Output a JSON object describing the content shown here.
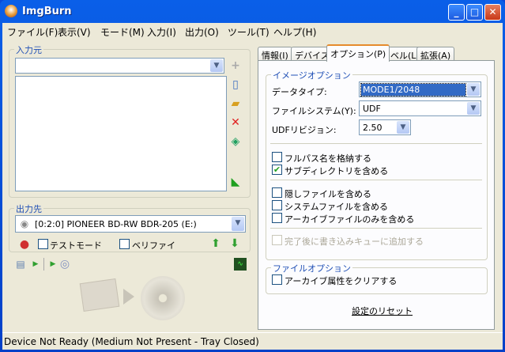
{
  "window": {
    "title": "ImgBurn",
    "minimize": "_",
    "maximize": "□",
    "close": "✕"
  },
  "menu": [
    "ファイル(F)",
    "表示(V)",
    "モード(M)",
    "入力(I)",
    "出力(O)",
    "ツール(T)",
    "ヘルプ(H)"
  ],
  "source": {
    "label": "入力元",
    "value": ""
  },
  "destination": {
    "label": "出力先",
    "drive": "[0:2:0] PIONEER BD-RW   BDR-205 (E:)",
    "test_mode": "テストモード",
    "verify": "ベリファイ"
  },
  "tabs": [
    "情報(I)",
    "デバイス",
    "オプション(P)",
    "ラベル(L)",
    "拡張(A)"
  ],
  "image_options": {
    "label": "イメージオプション",
    "data_type_label": "データタイプ:",
    "data_type": "MODE1/2048",
    "fs_label": "ファイルシステム(Y):",
    "fs": "UDF",
    "udf_rev_label": "UDFリビジョン:",
    "udf_rev": "2.50",
    "checks": [
      {
        "label": "フルパス名を格納する",
        "checked": false
      },
      {
        "label": "サブディレクトリを含める",
        "checked": true
      },
      {
        "label": "隠しファイルを含める",
        "checked": false
      },
      {
        "label": "システムファイルを含める",
        "checked": false
      },
      {
        "label": "アーカイブファイルのみを含める",
        "checked": false
      },
      {
        "label": "完了後に書き込みキューに追加する",
        "checked": false,
        "disabled": true
      }
    ]
  },
  "file_options": {
    "label": "ファイルオプション",
    "clear_archive": "アーカイブ属性をクリアする"
  },
  "reset": "設定のリセット",
  "status": "Device Not Ready (Medium Not Present - Tray Closed)"
}
